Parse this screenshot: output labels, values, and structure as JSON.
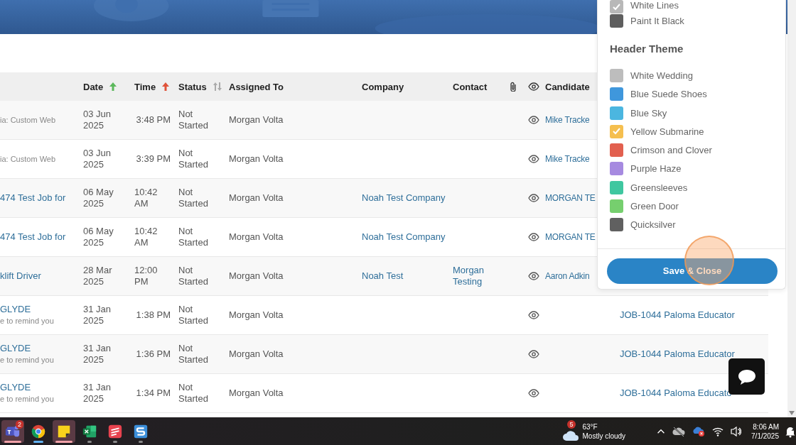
{
  "table": {
    "columns": [
      {
        "kind": "text",
        "label": "Date",
        "sorted": true,
        "color": "#5cb85c"
      },
      {
        "kind": "text",
        "label": "Time",
        "sorted": true,
        "color": "#e0533a"
      },
      {
        "kind": "text",
        "label": "Status",
        "sorted": false
      },
      {
        "kind": "text",
        "label": "Assigned To"
      },
      {
        "kind": "text",
        "label": "Company"
      },
      {
        "kind": "text",
        "label": "Contact"
      },
      {
        "kind": "attachment"
      },
      {
        "kind": "view"
      },
      {
        "kind": "text",
        "label": "Candidate"
      }
    ],
    "rows": [
      {
        "column_1": [
          {
            "kind": "note",
            "text": "ia: Custom Web"
          }
        ],
        "date": "03 Jun 2025",
        "time": "3:48 PM",
        "status": "Not Started",
        "assigned_to": "Morgan Volta",
        "company": "",
        "contact": "",
        "candidate": "Mike Tracke",
        "column_11": ""
      },
      {
        "column_1": [
          {
            "kind": "note",
            "text": "ia: Custom Web"
          }
        ],
        "date": "03 Jun 2025",
        "time": "3:39 PM",
        "status": "Not Started",
        "assigned_to": "Morgan Volta",
        "company": "",
        "contact": "",
        "candidate": "Mike Tracke",
        "column_11": ""
      },
      {
        "column_1": [
          {
            "kind": "link",
            "text": "474 Test Job for"
          }
        ],
        "date": "06 May 2025",
        "time": "10:42 AM",
        "status": "Not Started",
        "assigned_to": "Morgan Volta",
        "company": "Noah Test Company",
        "contact": "",
        "candidate": "MORGAN TE",
        "column_11": ""
      },
      {
        "column_1": [
          {
            "kind": "link",
            "text": "474 Test Job for"
          }
        ],
        "date": "06 May 2025",
        "time": "10:42 AM",
        "status": "Not Started",
        "assigned_to": "Morgan Volta",
        "company": "Noah Test Company",
        "contact": "",
        "candidate": "MORGAN TE",
        "column_11": ""
      },
      {
        "column_1": [
          {
            "kind": "link",
            "text": "klift Driver"
          }
        ],
        "date": "28 Mar 2025",
        "time": "12:00 PM",
        "status": "Not Started",
        "assigned_to": "Morgan Volta",
        "company": "Noah Test",
        "contact": "Morgan Testing",
        "candidate": "Aaron Adkin",
        "column_11": ""
      },
      {
        "column_1": [
          {
            "kind": "link",
            "text": "GLYDE"
          },
          {
            "kind": "note",
            "text": "e to remind you"
          }
        ],
        "date": "31 Jan 2025",
        "time": "1:38 PM",
        "status": "Not Started",
        "assigned_to": "Morgan Volta",
        "company": "",
        "contact": "",
        "candidate": "",
        "column_11": "JOB-1044 Paloma Educator"
      },
      {
        "column_1": [
          {
            "kind": "link",
            "text": "GLYDE"
          },
          {
            "kind": "note",
            "text": "e to remind you"
          }
        ],
        "date": "31 Jan 2025",
        "time": "1:36 PM",
        "status": "Not Started",
        "assigned_to": "Morgan Volta",
        "company": "",
        "contact": "",
        "candidate": "",
        "column_11": "JOB-1044 Paloma Educator"
      },
      {
        "column_1": [
          {
            "kind": "link",
            "text": "GLYDE"
          },
          {
            "kind": "note",
            "text": "e to remind you"
          }
        ],
        "date": "31 Jan 2025",
        "time": "1:34 PM",
        "status": "Not Started",
        "assigned_to": "Morgan Volta",
        "company": "",
        "contact": "",
        "candidate": "",
        "column_11": "JOB-1044 Paloma Educato"
      }
    ]
  },
  "theme_panel": {
    "body_themes": [
      {
        "label": "White Lines",
        "color": "#b8b8b8",
        "selected": true
      },
      {
        "label": "Paint It Black",
        "color": "#5e5e5e",
        "selected": false
      }
    ],
    "header_title": "Header Theme",
    "header_themes": [
      {
        "label": "White Wedding",
        "color": "#bdbdbd",
        "selected": false
      },
      {
        "label": "Blue Suede Shoes",
        "color": "#3f97dc",
        "selected": false
      },
      {
        "label": "Blue Sky",
        "color": "#4bb6e0",
        "selected": false
      },
      {
        "label": "Yellow Submarine",
        "color": "#f5bf4f",
        "selected": true
      },
      {
        "label": "Crimson and Clover",
        "color": "#e2604f",
        "selected": false
      },
      {
        "label": "Purple Haze",
        "color": "#a68ae0",
        "selected": false
      },
      {
        "label": "Greensleeves",
        "color": "#3fc7a0",
        "selected": false
      },
      {
        "label": "Green Door",
        "color": "#76cf6e",
        "selected": false
      },
      {
        "label": "Quicksilver",
        "color": "#606060",
        "selected": false
      }
    ],
    "save_button": "Save & Close"
  },
  "taskbar": {
    "apps": [
      {
        "kind": "teams",
        "badge": "2",
        "highlighted": true,
        "active": false
      },
      {
        "kind": "chrome",
        "highlighted": false,
        "active": true
      },
      {
        "kind": "notes",
        "highlighted": true,
        "active": false
      },
      {
        "kind": "excel",
        "highlighted": false,
        "active": false
      },
      {
        "kind": "red-app",
        "highlighted": false,
        "active": false
      },
      {
        "kind": "s-app",
        "highlighted": false,
        "active": false
      }
    ],
    "weather": {
      "badge": "5",
      "temperature": "63°F",
      "condition": "Mostly cloudy"
    },
    "time": "8:06 AM",
    "date": "7/1/2025"
  }
}
